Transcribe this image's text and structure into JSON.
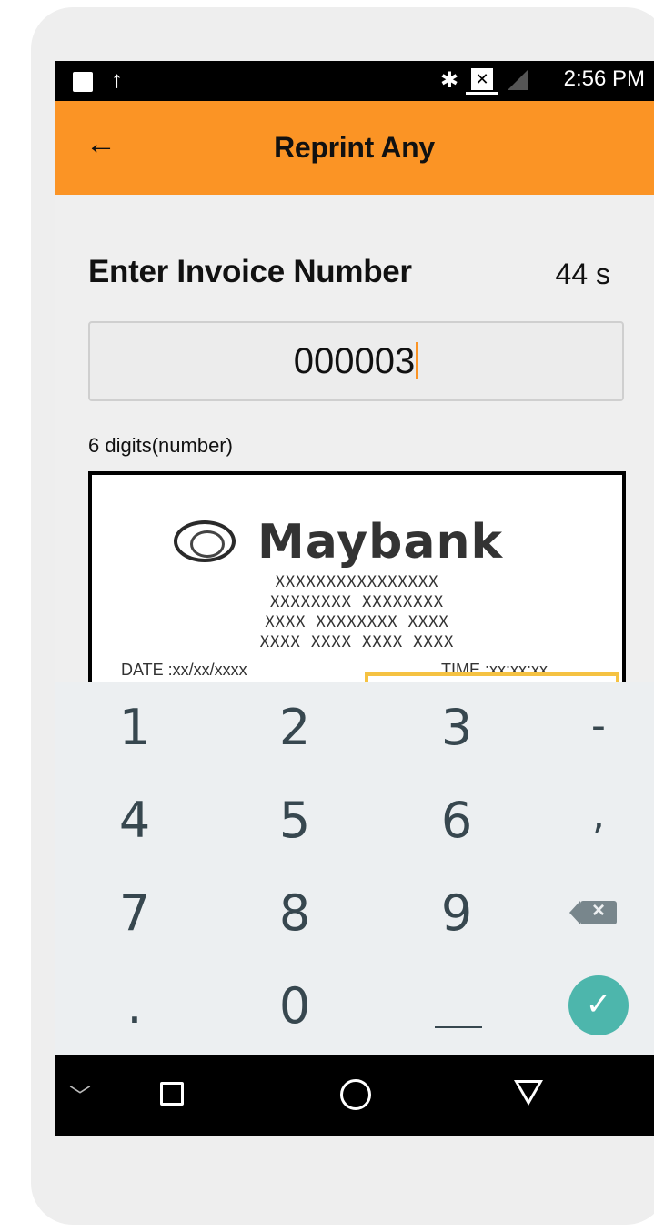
{
  "status_bar": {
    "time": "2:56 PM",
    "bluetooth_glyph": "✱",
    "upload_glyph": "↑",
    "sim_glyph": "✕"
  },
  "app_bar": {
    "back_glyph": "←",
    "title": "Reprint Any"
  },
  "form": {
    "label": "Enter Invoice Number",
    "timer": "44 s",
    "input_value": "000003",
    "hint": "6 digits(number)"
  },
  "receipt": {
    "brand": "Maybank",
    "masked_lines": [
      "XXXXXXXXXXXXXXXX",
      "XXXXXXXX XXXXXXXX",
      "XXXX XXXXXXXX XXXX",
      "XXXX XXXX XXXX XXXX"
    ],
    "date_label": "DATE :xx/xx/xxxx",
    "time_label": "TIME :xx:xx:xx"
  },
  "keyboard": {
    "keys": [
      "1",
      "2",
      "3",
      "-",
      "4",
      "5",
      "6",
      ",",
      "7",
      "8",
      "9",
      "",
      ".",
      "0",
      "",
      ""
    ],
    "backspace_glyph": "×",
    "enter_glyph": "✓"
  },
  "nav_bar": {
    "hide_glyph": "﹀"
  }
}
